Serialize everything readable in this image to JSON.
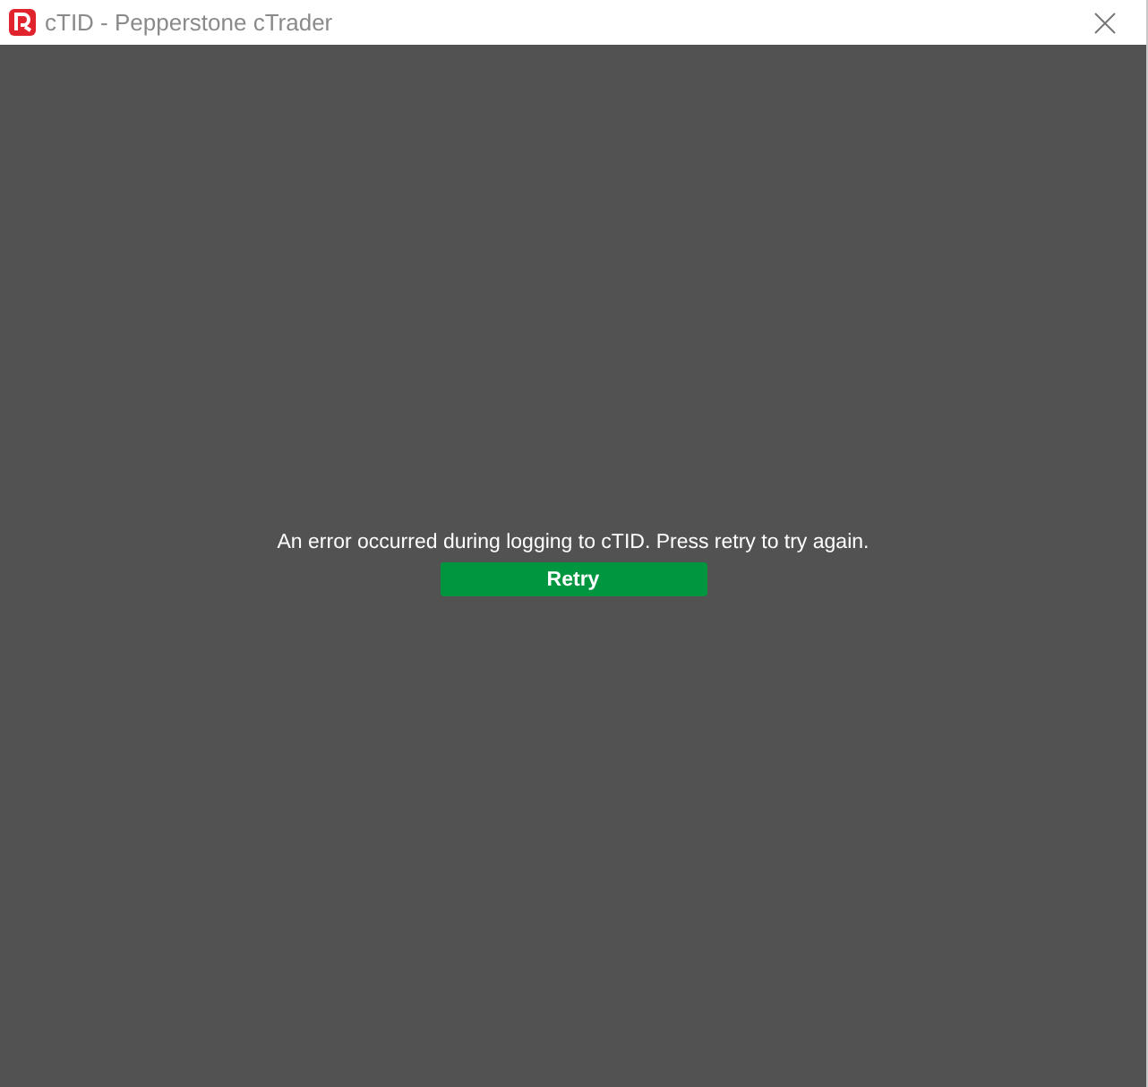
{
  "window": {
    "title": "cTID - Pepperstone cTrader"
  },
  "message": "An error occurred during logging to cTID. Press retry to try again.",
  "buttons": [
    {
      "label": "Retry"
    }
  ]
}
